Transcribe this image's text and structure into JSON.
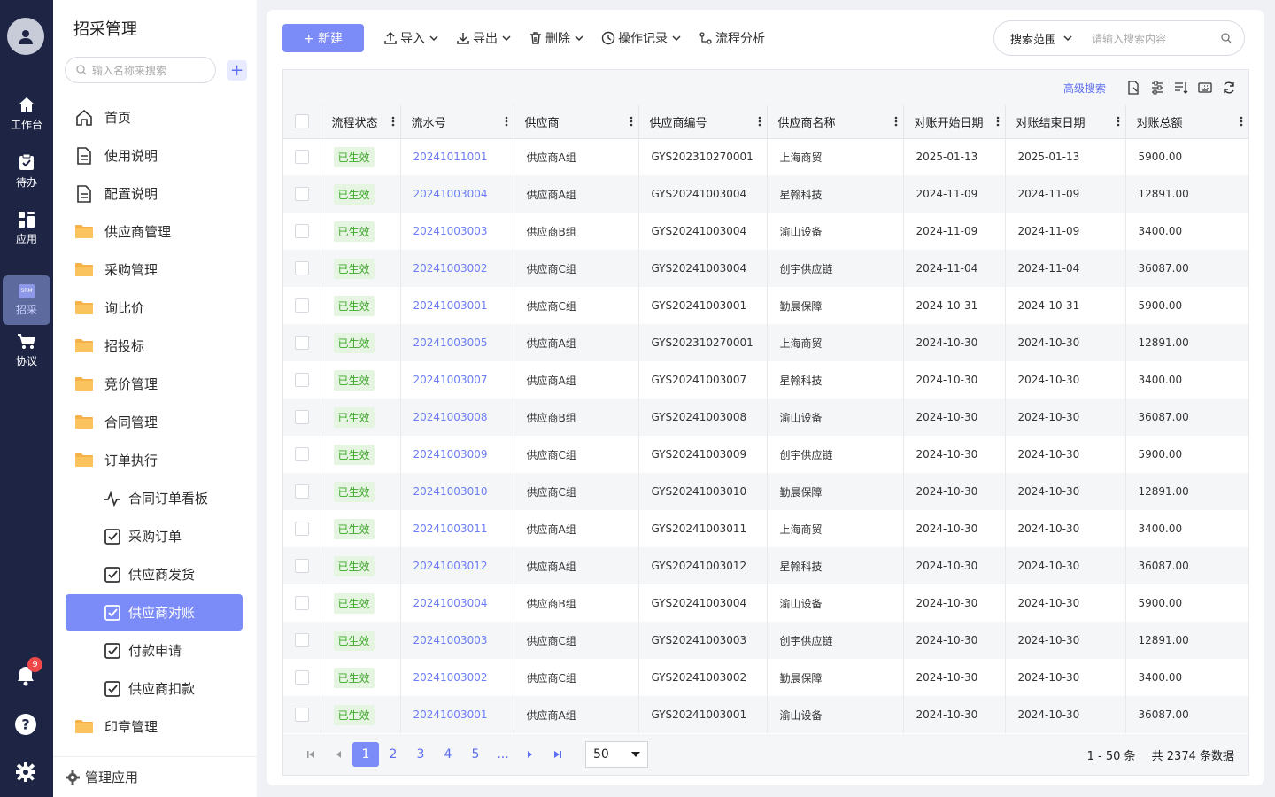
{
  "rail": {
    "items": [
      {
        "label": "工作台",
        "icon": "home-icon"
      },
      {
        "label": "待办",
        "icon": "clipboard-icon"
      },
      {
        "label": "应用",
        "icon": "apps-icon"
      },
      {
        "label": "招采",
        "icon": "srm-icon",
        "active": true,
        "logo_text": "SRM"
      },
      {
        "label": "协议",
        "icon": "cart-icon"
      }
    ],
    "notification_count": "9"
  },
  "sidebar": {
    "title": "招采管理",
    "search_placeholder": "输入名称来搜索",
    "add_label": "+",
    "menu": [
      {
        "label": "首页",
        "icon": "home-outline-icon"
      },
      {
        "label": "使用说明",
        "icon": "document-icon"
      },
      {
        "label": "配置说明",
        "icon": "document-icon"
      },
      {
        "label": "供应商管理",
        "icon": "folder-icon"
      },
      {
        "label": "采购管理",
        "icon": "folder-icon"
      },
      {
        "label": "询比价",
        "icon": "folder-icon"
      },
      {
        "label": "招投标",
        "icon": "folder-icon"
      },
      {
        "label": "竞价管理",
        "icon": "folder-icon"
      },
      {
        "label": "合同管理",
        "icon": "folder-icon"
      },
      {
        "label": "订单执行",
        "icon": "folder-icon"
      },
      {
        "label": "合同订单看板",
        "icon": "pulse-icon",
        "sub": true
      },
      {
        "label": "采购订单",
        "icon": "checkbox-icon",
        "sub": true
      },
      {
        "label": "供应商发货",
        "icon": "checkbox-icon",
        "sub": true
      },
      {
        "label": "供应商对账",
        "icon": "checkbox-icon",
        "sub": true,
        "active": true
      },
      {
        "label": "付款申请",
        "icon": "checkbox-icon",
        "sub": true
      },
      {
        "label": "供应商扣款",
        "icon": "checkbox-icon",
        "sub": true
      },
      {
        "label": "印章管理",
        "icon": "folder-icon"
      }
    ],
    "footer_label": "管理应用"
  },
  "toolbar": {
    "new_label": "+ 新建",
    "import_label": "导入",
    "export_label": "导出",
    "delete_label": "删除",
    "history_label": "操作记录",
    "flow_label": "流程分析",
    "search_scope": "搜索范围",
    "search_placeholder": "请输入搜索内容"
  },
  "grid": {
    "advanced_search": "高级搜索",
    "columns": [
      "流程状态",
      "流水号",
      "供应商",
      "供应商编号",
      "供应商名称",
      "对账开始日期",
      "对账结束日期",
      "对账总额"
    ],
    "rows": [
      [
        "已生效",
        "20241011001",
        "供应商A组",
        "GYS202310270001",
        "上海商贸",
        "2025-01-13",
        "2025-01-13",
        "5900.00"
      ],
      [
        "已生效",
        "20241003004",
        "供应商A组",
        "GYS20241003004",
        "星翰科技",
        "2024-11-09",
        "2024-11-09",
        "12891.00"
      ],
      [
        "已生效",
        "20241003003",
        "供应商B组",
        "GYS20241003004",
        "渝山设备",
        "2024-11-09",
        "2024-11-09",
        "3400.00"
      ],
      [
        "已生效",
        "20241003002",
        "供应商C组",
        "GYS20241003004",
        "创宇供应链",
        "2024-11-04",
        "2024-11-04",
        "36087.00"
      ],
      [
        "已生效",
        "20241003001",
        "供应商C组",
        "GYS20241003001",
        "勤晨保障",
        "2024-10-31",
        "2024-10-31",
        "5900.00"
      ],
      [
        "已生效",
        "20241003005",
        "供应商A组",
        "GYS202310270001",
        "上海商贸",
        "2024-10-30",
        "2024-10-30",
        "12891.00"
      ],
      [
        "已生效",
        "20241003007",
        "供应商A组",
        "GYS20241003007",
        "星翰科技",
        "2024-10-30",
        "2024-10-30",
        "3400.00"
      ],
      [
        "已生效",
        "20241003008",
        "供应商B组",
        "GYS20241003008",
        "渝山设备",
        "2024-10-30",
        "2024-10-30",
        "36087.00"
      ],
      [
        "已生效",
        "20241003009",
        "供应商C组",
        "GYS20241003009",
        "创宇供应链",
        "2024-10-30",
        "2024-10-30",
        "5900.00"
      ],
      [
        "已生效",
        "20241003010",
        "供应商C组",
        "GYS20241003010",
        "勤晨保障",
        "2024-10-30",
        "2024-10-30",
        "12891.00"
      ],
      [
        "已生效",
        "20241003011",
        "供应商A组",
        "GYS20241003011",
        "上海商贸",
        "2024-10-30",
        "2024-10-30",
        "3400.00"
      ],
      [
        "已生效",
        "20241003012",
        "供应商A组",
        "GYS20241003012",
        "星翰科技",
        "2024-10-30",
        "2024-10-30",
        "36087.00"
      ],
      [
        "已生效",
        "20241003004",
        "供应商B组",
        "GYS20241003004",
        "渝山设备",
        "2024-10-30",
        "2024-10-30",
        "5900.00"
      ],
      [
        "已生效",
        "20241003003",
        "供应商C组",
        "GYS20241003003",
        "创宇供应链",
        "2024-10-30",
        "2024-10-30",
        "12891.00"
      ],
      [
        "已生效",
        "20241003002",
        "供应商C组",
        "GYS20241003002",
        "勤晨保障",
        "2024-10-30",
        "2024-10-30",
        "3400.00"
      ],
      [
        "已生效",
        "20241003001",
        "供应商A组",
        "GYS20241003001",
        "渝山设备",
        "2024-10-30",
        "2024-10-30",
        "36087.00"
      ]
    ]
  },
  "pager": {
    "pages": [
      "1",
      "2",
      "3",
      "4",
      "5",
      "..."
    ],
    "current": "1",
    "page_size": "50",
    "range": "1 - 50 条",
    "total": "共 2374 条数据"
  },
  "colors": {
    "accent": "#7b8bf7",
    "rail_bg": "#1d2444",
    "link": "#6c7df5",
    "status_green": "#3ea82b"
  }
}
